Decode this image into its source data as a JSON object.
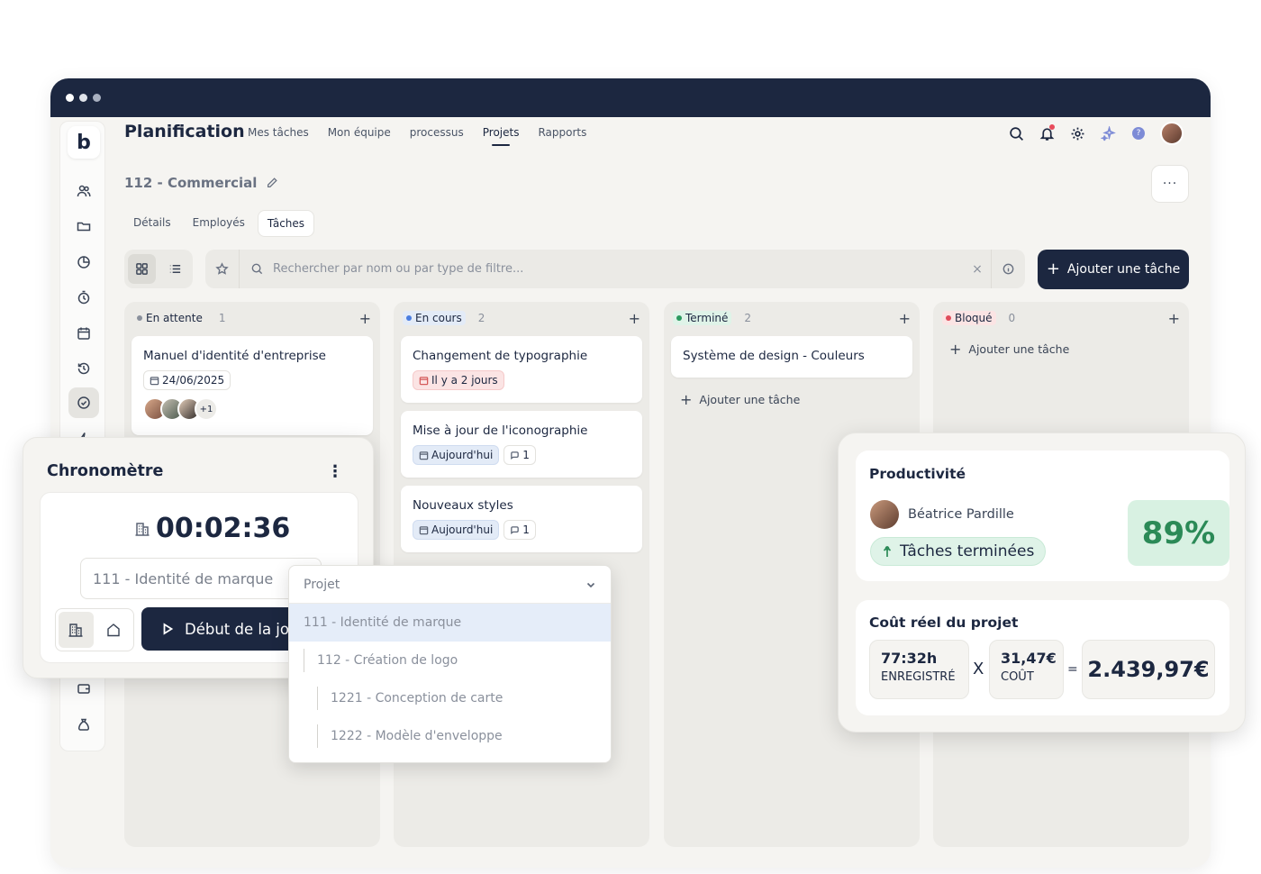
{
  "nav": {
    "title": "Planification",
    "items": [
      "Mes tâches",
      "Mon équipe",
      "processus",
      "Projets",
      "Rapports"
    ],
    "active": "Projets"
  },
  "sidebar": {
    "logo": "b",
    "icons": [
      "users-icon",
      "folder-icon",
      "pie-chart-icon",
      "timer-icon",
      "calendar-icon",
      "history-icon",
      "check-circle-icon",
      "bolt-icon",
      "wallet-icon",
      "money-bag-icon"
    ]
  },
  "project": {
    "title": "112 - Commercial",
    "more": "···"
  },
  "subtabs": [
    "Détails",
    "Employés",
    "Tâches"
  ],
  "search": {
    "placeholder": "Rechercher par nom ou par type de filtre...",
    "clear": "×"
  },
  "add_task_label": "Ajouter une tâche",
  "columns": [
    {
      "name": "En attente",
      "count": "1",
      "color": "#8a909c",
      "badge_bg": "transparent",
      "cards": [
        {
          "title": "Manuel d'identité d'entreprise",
          "date": "24/06/2025",
          "extra": "+1"
        }
      ]
    },
    {
      "name": "En cours",
      "count": "2",
      "color": "#4a7de0",
      "badge_bg": "#e3ebf7",
      "cards": [
        {
          "title": "Changement de typographie",
          "chip": "Il y a 2 jours"
        },
        {
          "title": "Mise à jour de l'iconographie",
          "chip": "Aujourd'hui",
          "comments": "1"
        },
        {
          "title": "Nouveaux styles",
          "chip": "Aujourd'hui",
          "comments": "1"
        }
      ]
    },
    {
      "name": "Terminé",
      "count": "2",
      "color": "#2b9a5f",
      "badge_bg": "#dff3e8",
      "cards": [
        {
          "title": "Système de design - Couleurs"
        }
      ],
      "add_label": "Ajouter une tâche"
    },
    {
      "name": "Bloqué",
      "count": "0",
      "color": "#e04b5b",
      "badge_bg": "#fbe4e4",
      "cards": [],
      "add_label": "Ajouter une tâche"
    }
  ],
  "stopwatch": {
    "title": "Chronomètre",
    "time": "00:02:36",
    "project": "111 - Identité de marque",
    "start_label": "Début de la journée"
  },
  "dropdown": {
    "placeholder": "Projet",
    "items": [
      {
        "label": "111 - Identité de marque",
        "level": 0,
        "selected": true
      },
      {
        "label": "112 - Création de logo",
        "level": 1
      },
      {
        "label": "1221 - Conception de carte",
        "level": 2
      },
      {
        "label": "1222 - Modèle d'enveloppe",
        "level": 2
      }
    ]
  },
  "productivity": {
    "title": "Productivité",
    "user": "Béatrice Pardille",
    "pill": "Tâches terminées",
    "percent": "89%"
  },
  "cost": {
    "title": "Coût réel du projet",
    "hours_value": "77:32h",
    "hours_label": "ENREGISTRÉ",
    "times": "X",
    "rate_value": "31,47€",
    "rate_label": "COÛT",
    "equals": "=",
    "total": "2.439,97€"
  }
}
